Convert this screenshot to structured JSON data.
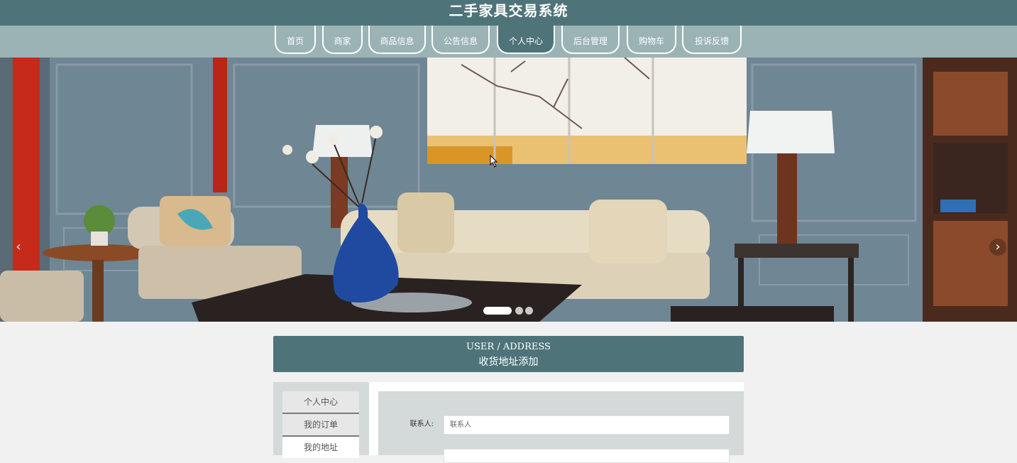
{
  "header": {
    "title": "二手家具交易系统"
  },
  "nav": {
    "items": [
      {
        "label": "首页"
      },
      {
        "label": "商家"
      },
      {
        "label": "商品信息"
      },
      {
        "label": "公告信息"
      },
      {
        "label": "个人中心"
      },
      {
        "label": "后台管理"
      },
      {
        "label": "购物车"
      },
      {
        "label": "投诉反馈"
      }
    ],
    "active": "个人中心"
  },
  "banner": {
    "prev_icon": "‹",
    "next_icon": "›",
    "slide_count": 3,
    "active_slide": 1
  },
  "section": {
    "title_en": "USER / ADDRESS",
    "title_cn": "收货地址添加"
  },
  "sidebar": {
    "items": [
      {
        "label": "个人中心"
      },
      {
        "label": "我的订单"
      },
      {
        "label": "我的地址"
      }
    ],
    "active": "我的地址"
  },
  "form": {
    "contact_label": "联系人:",
    "contact_placeholder": "联系人"
  },
  "colors": {
    "primary": "#4e747a",
    "nav_bg": "#9bb3b4",
    "page_bg": "#f1f1f1",
    "panel_bg": "#d4d9da"
  }
}
